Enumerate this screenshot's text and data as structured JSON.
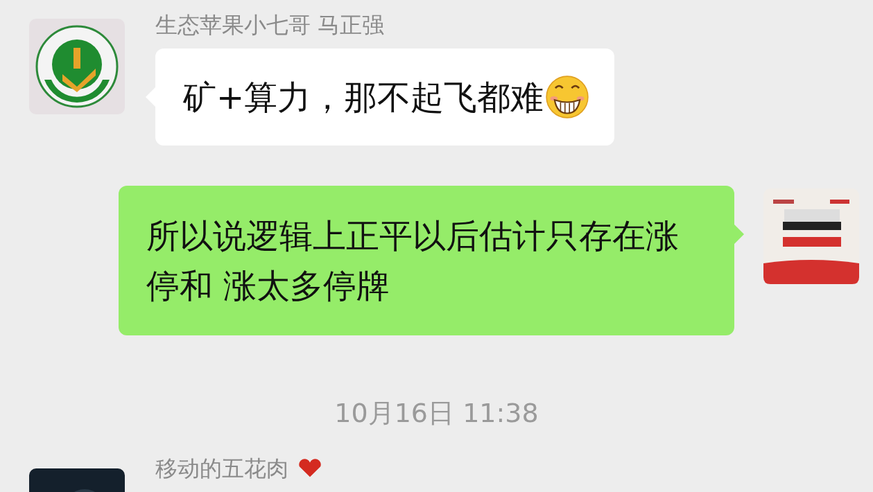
{
  "messages": [
    {
      "kind": "received",
      "sender": "生态苹果小七哥 马正强",
      "text": "矿+算力，那不起飞都难",
      "emoji": true
    },
    {
      "kind": "sent",
      "text": "所以说逻辑上正平以后估计只存在涨停和 涨太多停牌"
    },
    {
      "kind": "time",
      "text": "10月16日 11:38"
    },
    {
      "kind": "received_cut",
      "sender": "移动的五花肉"
    }
  ]
}
